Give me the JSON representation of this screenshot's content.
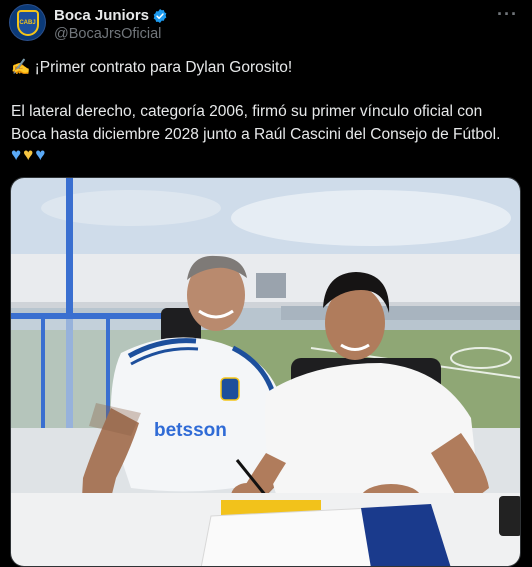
{
  "author": {
    "display_name": "Boca Juniors",
    "handle": "@BocaJrsOficial",
    "avatar_icon": "boca-crest-icon",
    "verified": true,
    "crest_text": "CABJ"
  },
  "tweet": {
    "line1": "✍️ ¡Primer contrato para Dylan Gorosito!",
    "line2": "El lateral derecho, categoría 2006, firmó su primer vínculo oficial con",
    "line3": "Boca hasta diciembre 2028 junto a Raúl Cascini del Consejo de Fútbol.",
    "hearts": [
      "♥",
      "♥",
      "♥"
    ]
  },
  "photo": {
    "shirt_sponsor": "betsson"
  },
  "colors": {
    "accent_blue": "#1d9bf0",
    "boca_blue": "#1d4f9c",
    "boca_yellow": "#f5c518"
  }
}
